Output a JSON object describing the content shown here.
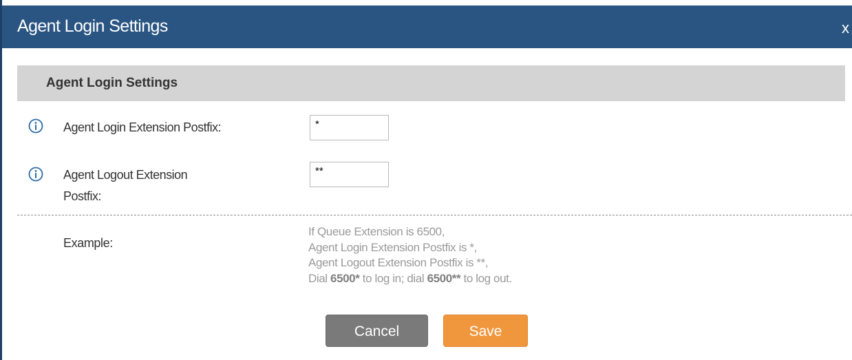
{
  "dialog": {
    "title": "Agent Login Settings",
    "close_label": "x"
  },
  "section": {
    "header": "Agent Login Settings"
  },
  "fields": {
    "login_postfix": {
      "label": "Agent Login Extension Postfix:",
      "value": "*"
    },
    "logout_postfix": {
      "label_line1": "Agent Logout Extension",
      "label_line2": "Postfix:",
      "value": "**"
    }
  },
  "example": {
    "label": "Example:",
    "line1": "If Queue Extension is 6500,",
    "line2": "Agent Login Extension Postfix is *,",
    "line3": "Agent Logout Extension Postfix is **,",
    "line4_pre": "Dial ",
    "line4_login_code": "6500*",
    "line4_mid": " to log in; dial ",
    "line4_logout_code": "6500**",
    "line4_post": " to log out."
  },
  "buttons": {
    "cancel": "Cancel",
    "save": "Save"
  },
  "colors": {
    "titlebar": "#2a5582",
    "section_header": "#d4d4d4",
    "cancel_button": "#7a7a7a",
    "save_button": "#f0973e",
    "info_icon": "#2a6aa8"
  },
  "icons": {
    "field_info": "info-circle-icon"
  }
}
